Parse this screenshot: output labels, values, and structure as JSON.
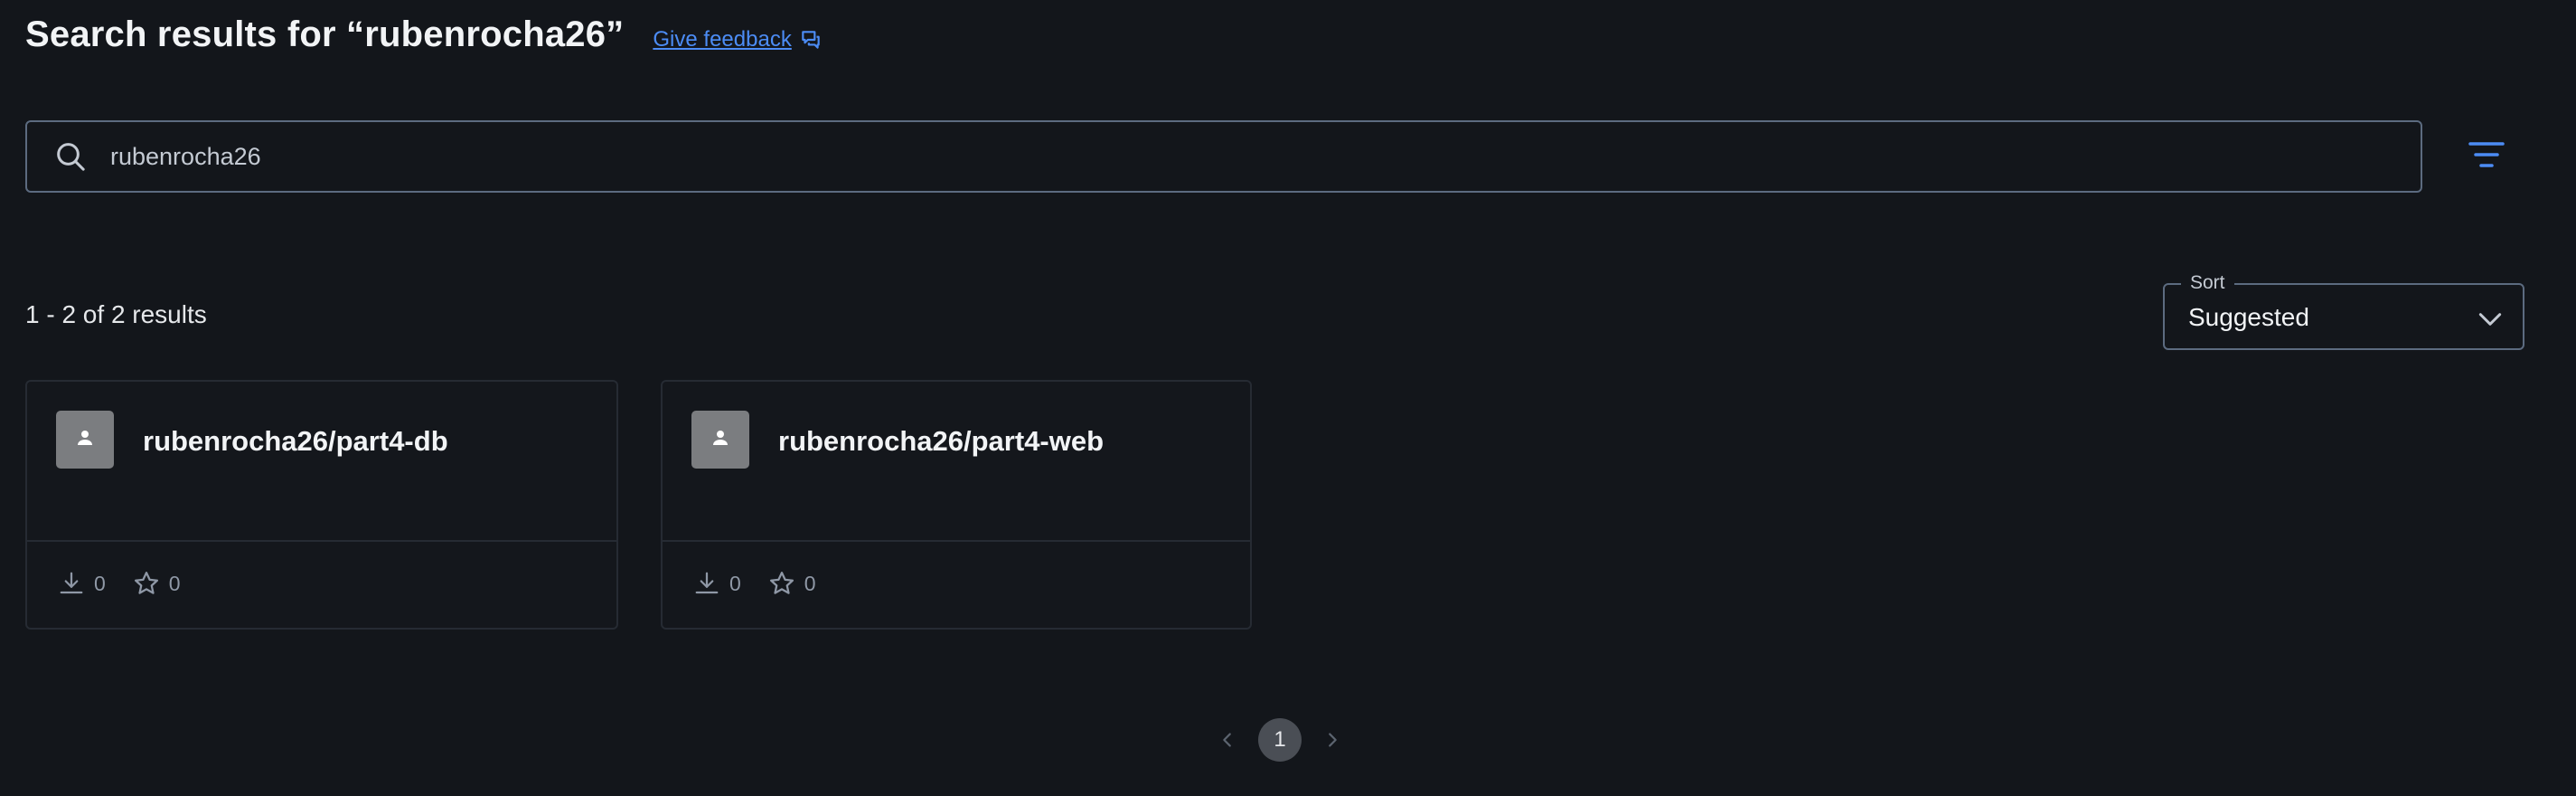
{
  "header": {
    "title": "Search results for “rubenrocha26”",
    "feedback_label": "Give feedback",
    "feedback_icon": "feedback-icon"
  },
  "search": {
    "value": "rubenrocha26",
    "icon": "search-icon"
  },
  "filter": {
    "icon": "filter-icon"
  },
  "results": {
    "count_text": "1 - 2 of 2 results"
  },
  "sort": {
    "legend": "Sort",
    "value": "Suggested",
    "icon": "chevron-down-icon"
  },
  "cards": [
    {
      "title": "rubenrocha26/part4-db",
      "downloads": "0",
      "stars": "0"
    },
    {
      "title": "rubenrocha26/part4-web",
      "downloads": "0",
      "stars": "0"
    }
  ],
  "pagination": {
    "current_page": "1",
    "prev_icon": "chevron-left-icon",
    "next_icon": "chevron-right-icon"
  },
  "colors": {
    "background": "#13161b",
    "accent": "#4c8cf5",
    "border": "#5c6b80",
    "card_border": "#262b33",
    "avatar": "#7b7d80"
  }
}
